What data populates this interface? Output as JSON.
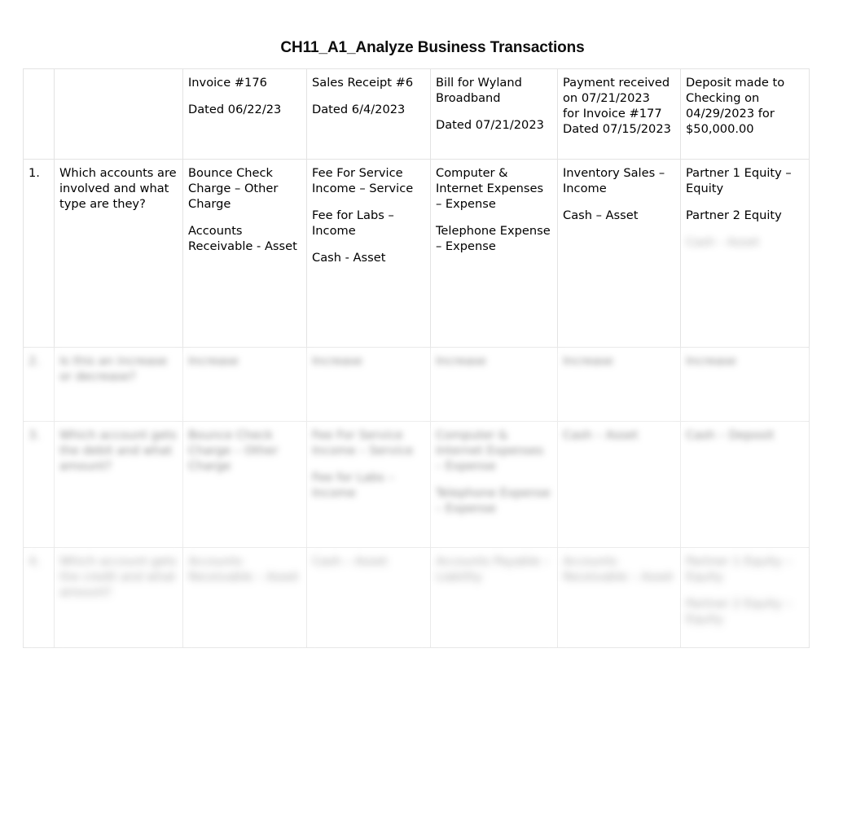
{
  "document": {
    "title": "CH11_A1_Analyze Business Transactions"
  },
  "table": {
    "header": {
      "num": "",
      "question": "",
      "transactions": [
        {
          "line1": "Invoice #176",
          "line2": "Dated 06/22/23",
          "line3": "",
          "line4": ""
        },
        {
          "line1": "Sales Receipt #6",
          "line2": "Dated 6/4/2023",
          "line3": "",
          "line4": ""
        },
        {
          "line1": "Bill for Wyland Broadband",
          "line2": "Dated 07/21/2023",
          "line3": "",
          "line4": ""
        },
        {
          "line1": "Payment received on 07/21/2023",
          "line2": "for Invoice #177",
          "line3": "Dated 07/15/2023",
          "line4": ""
        },
        {
          "line1": "Deposit made to Checking on 04/29/2023 for $50,000.00",
          "line2": "",
          "line3": "",
          "line4": ""
        }
      ]
    },
    "rows": [
      {
        "num": "1.",
        "question": "Which accounts are involved and what type are they?",
        "answers": [
          {
            "p1": "Bounce Check Charge – Other Charge",
            "p2": "Accounts Receivable - Asset",
            "p3": ""
          },
          {
            "p1": "Fee For Service Income – Service",
            "p2": "Fee for Labs – Income",
            "p3": "Cash - Asset"
          },
          {
            "p1": "Computer & Internet Expenses – Expense",
            "p2": "Telephone Expense – Expense",
            "p3": ""
          },
          {
            "p1": "Inventory Sales – Income",
            "p2": "Cash – Asset",
            "p3": ""
          },
          {
            "p1": "Partner 1 Equity – Equity",
            "p2": "Partner 2 Equity",
            "p3": "Cash - Asset"
          }
        ]
      },
      {
        "num": "2.",
        "question": "Is this an increase or decrease?",
        "answers": [
          {
            "p1": "Increase",
            "p2": "",
            "p3": ""
          },
          {
            "p1": "Increase",
            "p2": "",
            "p3": ""
          },
          {
            "p1": "Increase",
            "p2": "",
            "p3": ""
          },
          {
            "p1": "Increase",
            "p2": "",
            "p3": ""
          },
          {
            "p1": "Increase",
            "p2": "",
            "p3": ""
          }
        ]
      },
      {
        "num": "3.",
        "question": "Which account gets the debit and what amount?",
        "answers": [
          {
            "p1": "Bounce Check Charge – Other Charge",
            "p2": "",
            "p3": ""
          },
          {
            "p1": "Fee For Service Income – Service",
            "p2": "Fee for Labs – Income",
            "p3": ""
          },
          {
            "p1": "Computer & Internet Expenses – Expense",
            "p2": "Telephone Expense – Expense",
            "p3": ""
          },
          {
            "p1": "Cash – Asset",
            "p2": "",
            "p3": ""
          },
          {
            "p1": "Cash – Deposit",
            "p2": "",
            "p3": ""
          }
        ]
      },
      {
        "num": "4.",
        "question": "Which account gets the credit and what amount?",
        "answers": [
          {
            "p1": "Accounts Receivable – Asset",
            "p2": "",
            "p3": ""
          },
          {
            "p1": "Cash – Asset",
            "p2": "",
            "p3": ""
          },
          {
            "p1": "Accounts Payable – Liability",
            "p2": "",
            "p3": ""
          },
          {
            "p1": "Accounts Receivable – Asset",
            "p2": "",
            "p3": ""
          },
          {
            "p1": "Partner 1 Equity – Equity",
            "p2": "Partner 2 Equity – Equity",
            "p3": ""
          }
        ]
      }
    ]
  }
}
